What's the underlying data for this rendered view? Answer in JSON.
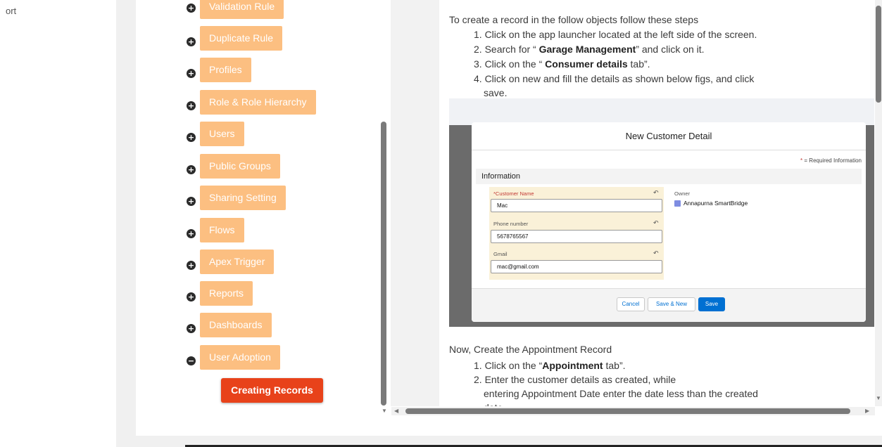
{
  "left_nav": {
    "partial_text": "ort"
  },
  "tree": {
    "items": [
      {
        "label": "Validation Rule",
        "expanded": false
      },
      {
        "label": "Duplicate Rule",
        "expanded": false
      },
      {
        "label": "Profiles",
        "expanded": false
      },
      {
        "label": "Role & Role Hierarchy",
        "expanded": false
      },
      {
        "label": "Users",
        "expanded": false
      },
      {
        "label": "Public Groups",
        "expanded": false
      },
      {
        "label": "Sharing Setting",
        "expanded": false
      },
      {
        "label": "Flows",
        "expanded": false
      },
      {
        "label": "Apex Trigger",
        "expanded": false
      },
      {
        "label": "Reports",
        "expanded": false
      },
      {
        "label": "Dashboards",
        "expanded": false
      },
      {
        "label": "User Adoption",
        "expanded": true
      }
    ],
    "active_child": "Creating Records",
    "plus_glyph": "+",
    "minus_glyph": "−"
  },
  "content": {
    "intro": "To create a record in the follow objects follow these steps",
    "steps": [
      {
        "pre": "1. Click on the app launcher located at the left side of the screen.",
        "bold": "",
        "post": ""
      },
      {
        "pre": "2. Search for “ ",
        "bold": "Garage Management",
        "post": "” and click on it."
      },
      {
        "pre": "3. Click on the “ ",
        "bold": "Consumer details",
        "post": " tab”."
      },
      {
        "pre": "4. Click on new and fill the details as shown below figs, and click",
        "bold": "",
        "post": ""
      }
    ],
    "step4_cont": "save.",
    "modal": {
      "title": "New Customer Detail",
      "required_note": "= Required Information",
      "section": "Information",
      "fields": [
        {
          "label": "Customer Name",
          "required": true,
          "value": "Mac"
        },
        {
          "label": "Phone number",
          "required": false,
          "value": "5678765567"
        },
        {
          "label": "Gmail",
          "required": false,
          "value": "mac@gmail.com"
        }
      ],
      "owner_label": "Owner",
      "owner_value": "Annapurna SmartBridge",
      "buttons": {
        "cancel": "Cancel",
        "save_new": "Save & New",
        "save": "Save"
      }
    },
    "appointment_intro": "Now, Create the Appointment Record",
    "appt_steps": [
      {
        "pre": "1. Click on the “",
        "bold": "Appointment",
        "post": " tab”."
      },
      {
        "pre": "2. Enter the customer details as created, while",
        "bold": "",
        "post": ""
      }
    ],
    "appt_step2_cont": "entering Appointment Date enter the date less than the created",
    "appt_step2_cont2": "date."
  },
  "colors": {
    "tree_item_bg": "#fcbf81",
    "active_bg": "#e8421a",
    "salesforce_blue": "#0070d2"
  }
}
